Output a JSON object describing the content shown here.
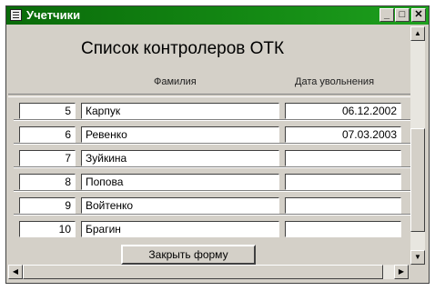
{
  "window": {
    "title": "Учетчики",
    "buttons": {
      "minimize": "_",
      "maximize": "□",
      "close": "✕"
    }
  },
  "form": {
    "title": "Список контролеров ОТК",
    "columns": {
      "surname": "Фамилия",
      "dismissal_date": "Дата увольнения"
    },
    "rows": [
      {
        "num": "5",
        "name": "Карпук",
        "date": "06.12.2002"
      },
      {
        "num": "6",
        "name": "Ревенко",
        "date": "07.03.2003"
      },
      {
        "num": "7",
        "name": "Зуйкина",
        "date": ""
      },
      {
        "num": "8",
        "name": "Попова",
        "date": ""
      },
      {
        "num": "9",
        "name": "Войтенко",
        "date": ""
      },
      {
        "num": "10",
        "name": "Брагин",
        "date": ""
      }
    ],
    "close_button": "Закрыть форму"
  },
  "scrollbar": {
    "up": "▲",
    "down": "▼",
    "left": "◀",
    "right": "▶"
  },
  "colors": {
    "titlebar": "#148a14",
    "face": "#d4d0c8",
    "field": "#ffffff"
  },
  "icons": {
    "window_icon": "form-icon"
  }
}
